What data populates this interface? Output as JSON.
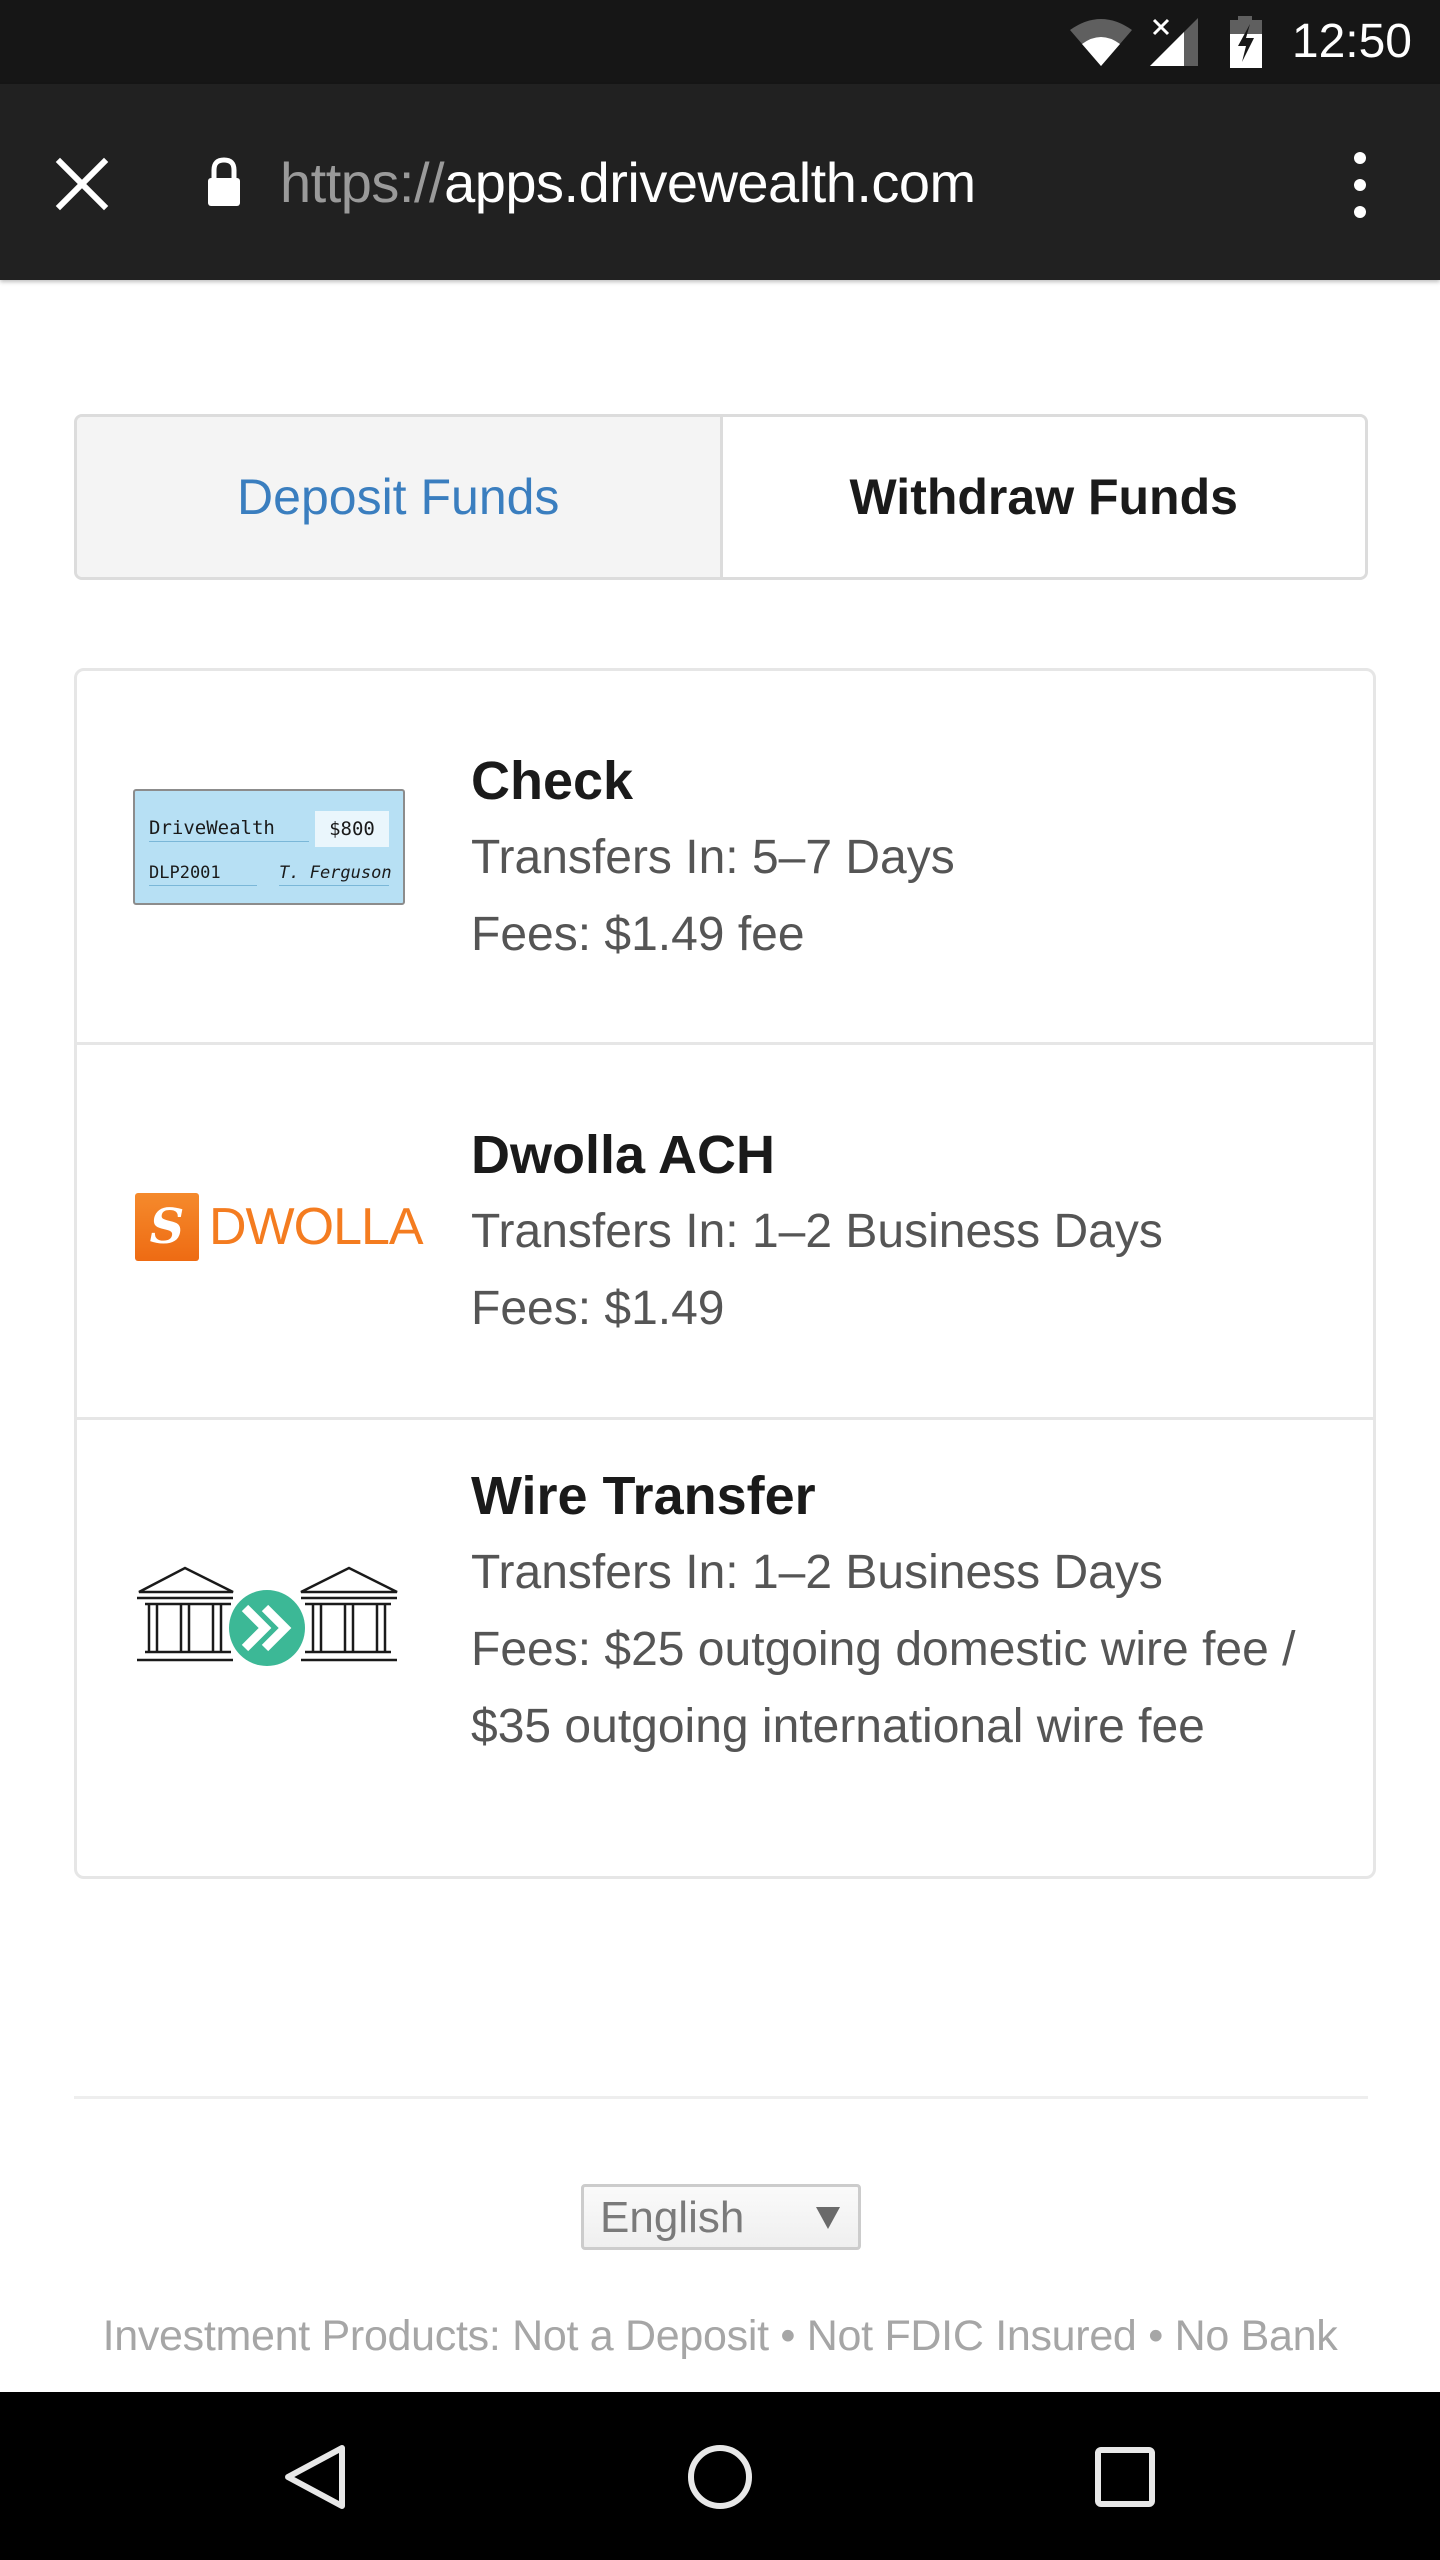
{
  "status_bar": {
    "time": "12:50",
    "icons": [
      "wifi-icon",
      "signal-no-data-icon",
      "battery-charging-icon"
    ]
  },
  "browser": {
    "close_icon": "close-icon",
    "lock_icon": "lock-icon",
    "url_scheme": "https://",
    "url_host": "apps.drivewealth.com",
    "menu_icon": "more-vert-icon"
  },
  "tabs": [
    {
      "label": "Deposit Funds",
      "active": false
    },
    {
      "label": "Withdraw Funds",
      "active": true
    }
  ],
  "methods": [
    {
      "title": "Check",
      "transfers": "Transfers In:  5–7 Days",
      "fees": "Fees:  $1.49 fee",
      "logo": {
        "type": "check-image",
        "payee": "DriveWealth",
        "amount": "$800",
        "memo": "DLP2001",
        "signature": "T. Ferguson"
      }
    },
    {
      "title": "Dwolla ACH",
      "transfers": "Transfers In:  1–2 Business Days",
      "fees": "Fees:  $1.49",
      "logo": {
        "type": "dwolla-logo",
        "mark": "S",
        "wordmark": "DWOLLA",
        "color": "#f47c20"
      }
    },
    {
      "title": "Wire Transfer",
      "transfers": "Transfers In:  1–2 Business Days",
      "fees": "Fees:  $25 outgoing domestic wire fee / $35 outgoing international wire fee",
      "logo": {
        "type": "bank-transfer-icon",
        "color": "#3cb896"
      }
    }
  ],
  "footer": {
    "language": "English",
    "disclaimer": "Investment Products: Not a Deposit • Not FDIC Insured • No Bank"
  },
  "nav_bar": {
    "icons": [
      "back-icon",
      "home-icon",
      "recents-icon"
    ]
  },
  "colors": {
    "link_blue": "#3a7ebf",
    "toolbar": "#212121",
    "status_bar": "#161616",
    "wire_green": "#3cb896",
    "dwolla_orange": "#f47c20"
  }
}
